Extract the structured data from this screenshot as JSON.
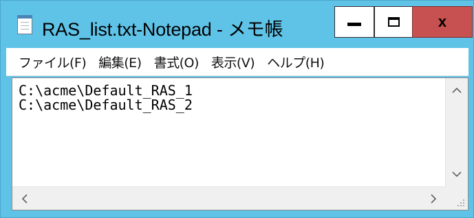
{
  "window": {
    "title": "RAS_list.txt-Notepad - メモ帳",
    "title_bar_color": "#5fc3e8",
    "close_button_color": "#c75050"
  },
  "caption_buttons": {
    "minimize_icon": "minimize-icon",
    "maximize_icon": "maximize-icon",
    "close_glyph": "x"
  },
  "menu": {
    "items": [
      {
        "label": "ファイル(F)"
      },
      {
        "label": "編集(E)"
      },
      {
        "label": "書式(O)"
      },
      {
        "label": "表示(V)"
      },
      {
        "label": "ヘルプ(H)"
      }
    ]
  },
  "editor": {
    "lines": [
      "C:\\acme\\Default_RAS_1",
      "C:\\acme\\Default_RAS_2"
    ]
  },
  "scrollbars": {
    "up": "^",
    "down": "v",
    "left": "<",
    "right": ">"
  }
}
